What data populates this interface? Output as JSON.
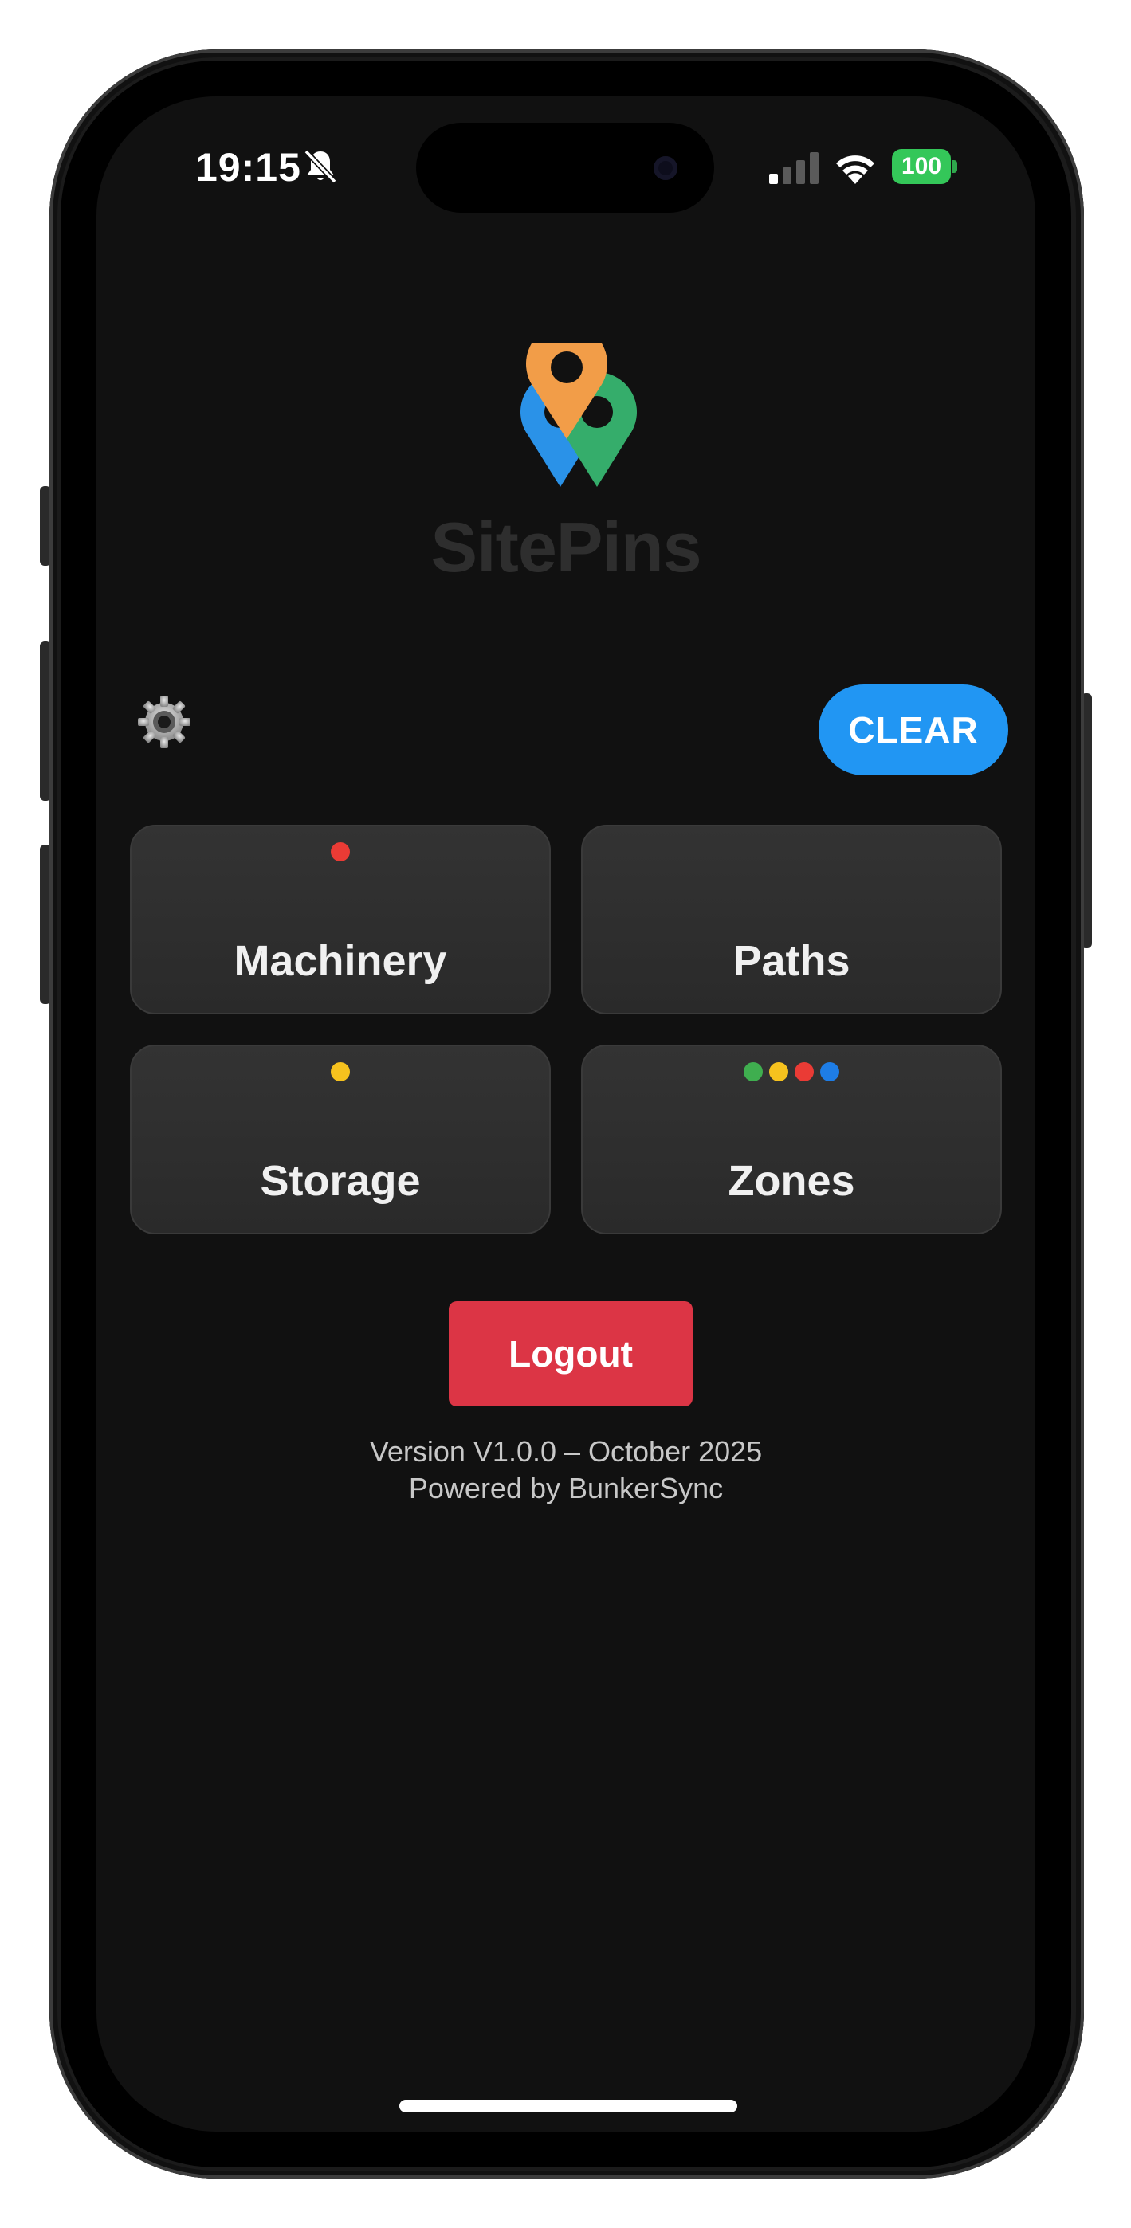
{
  "status_bar": {
    "time": "19:15",
    "battery": "100",
    "icons": [
      "bell-slash-icon",
      "signal-icon",
      "wifi-icon",
      "battery-icon"
    ]
  },
  "app": {
    "title": "SitePins",
    "logo_colors": [
      "#f29d48",
      "#2a92e8",
      "#35ad6b"
    ]
  },
  "toolbar": {
    "settings_icon": "gear-icon",
    "clear_label": "CLEAR"
  },
  "categories": [
    {
      "label": "Machinery",
      "dots": [
        "#ea3b35"
      ]
    },
    {
      "label": "Paths",
      "dots": []
    },
    {
      "label": "Storage",
      "dots": [
        "#f6c21e"
      ]
    },
    {
      "label": "Zones",
      "dots": [
        "#3fae4f",
        "#f6c21e",
        "#ea3b35",
        "#1e7de6"
      ]
    }
  ],
  "actions": {
    "logout_label": "Logout"
  },
  "footer": {
    "version": "Version V1.0.0 – October 2025",
    "powered_by": "Powered by BunkerSync"
  },
  "colors": {
    "background": "#111111",
    "accent_blue": "#2196f3",
    "danger_red": "#dc3545"
  }
}
